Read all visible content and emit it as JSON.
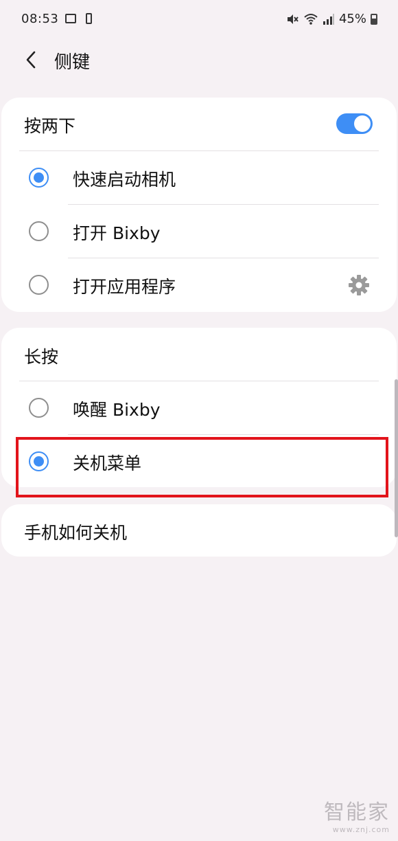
{
  "status_bar": {
    "time": "08:53",
    "battery": "45%",
    "icons": [
      "image-icon",
      "phone-icon",
      "mute-icon",
      "wifi-icon",
      "signal-icon",
      "battery-icon"
    ]
  },
  "header": {
    "title": "侧键"
  },
  "double_press": {
    "title": "按两下",
    "toggle_on": true,
    "options": [
      {
        "label": "快速启动相机",
        "checked": true
      },
      {
        "label": "打开 Bixby",
        "checked": false
      },
      {
        "label": "打开应用程序",
        "checked": false
      }
    ]
  },
  "long_press": {
    "title": "长按",
    "options": [
      {
        "label": "唤醒 Bixby",
        "checked": false
      },
      {
        "label": "关机菜单",
        "checked": true
      }
    ]
  },
  "link": {
    "label": "手机如何关机"
  },
  "watermark": {
    "logo": "智能家",
    "url": "www.znj.com"
  },
  "colors": {
    "accent": "#3e8ef5",
    "background": "#f6f1f4",
    "highlight": "#e2141b"
  }
}
